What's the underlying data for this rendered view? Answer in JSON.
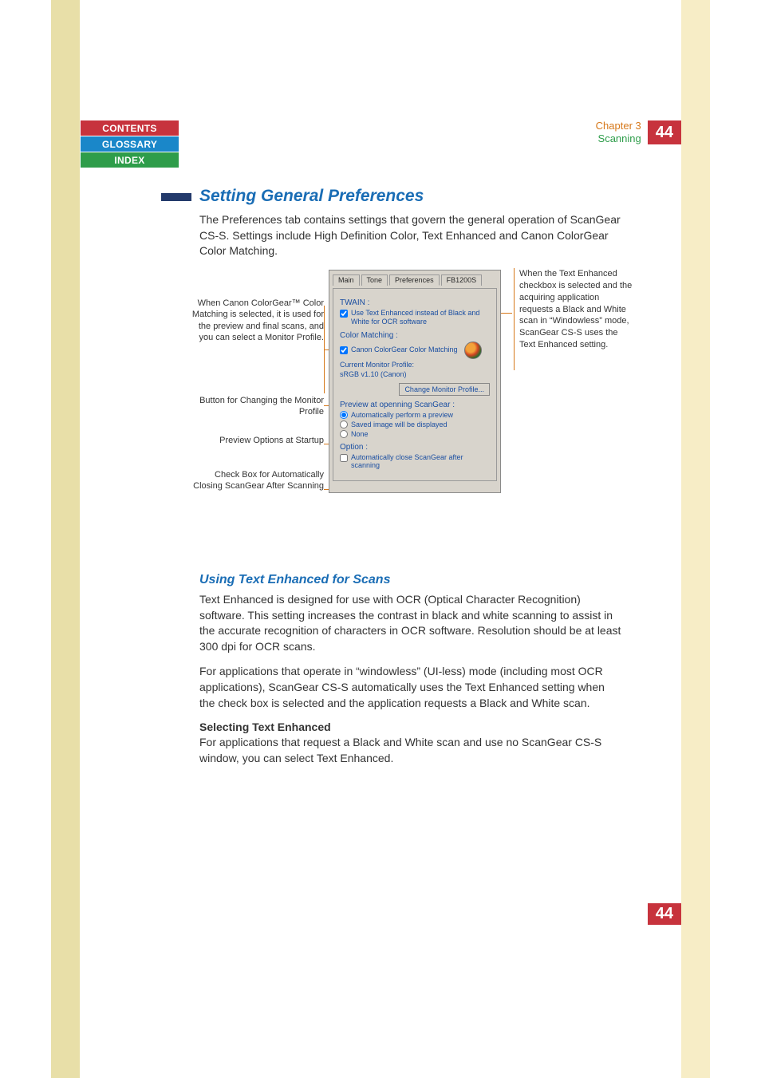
{
  "nav": {
    "contents": "CONTENTS",
    "glossary": "GLOSSARY",
    "index": "INDEX"
  },
  "header": {
    "chapter": "Chapter 3",
    "section": "Scanning",
    "page": "44"
  },
  "main": {
    "h2": "Setting General Preferences",
    "intro": "The Preferences tab contains settings that govern the general operation of ScanGear CS-S. Settings include High Definition Color, Text Enhanced and Canon ColorGear Color Matching.",
    "h3": "Using Text Enhanced for Scans",
    "p1": "Text Enhanced is designed for use with OCR (Optical Character Recognition) software. This setting increases the contrast in black and white scanning to assist in the accurate recognition of characters in OCR software. Resolution should be at least 300 dpi for OCR scans.",
    "p2": "For applications that operate in “windowless” (UI-less) mode (including most OCR applications), ScanGear CS-S automatically uses the Text Enhanced setting when the check box is selected and the application requests a Black and White scan.",
    "bold": "Selecting Text Enhanced",
    "p3": "For applications that request a Black and White scan and use no ScanGear CS-S window, you can select Text Enhanced."
  },
  "callouts": {
    "left1": "When Canon ColorGear™ Color Matching is selected, it is used for the preview and final scans, and you can select a Monitor Profile.",
    "left2": "Button for Changing the Monitor Profile",
    "left3": "Preview Options at Startup",
    "left4": "Check Box for Automatically Closing ScanGear After Scanning",
    "right": "When the Text Enhanced checkbox is selected and the acquiring application requests a Black and White scan in “Windowless” mode, ScanGear CS-S uses the Text Enhanced setting."
  },
  "panel": {
    "tabs": {
      "main": "Main",
      "tone": "Tone",
      "prefs": "Preferences",
      "model": "FB1200S"
    },
    "twain_label": "TWAIN :",
    "twain_check": "Use Text Enhanced instead of Black and White for OCR software",
    "cm_label": "Color Matching :",
    "cm_check": "Canon ColorGear Color Matching",
    "cm_profile_label": "Current Monitor Profile:",
    "cm_profile_value": "sRGB v1.10 (Canon)",
    "change_btn": "Change Monitor Profile...",
    "preview_label": "Preview at openning ScanGear :",
    "radio_auto": "Automatically perform a preview",
    "radio_saved": "Saved image will be displayed",
    "radio_none": "None",
    "option_label": "Option :",
    "option_check": "Automatically close ScanGear after scanning"
  },
  "footer": {
    "page": "44"
  }
}
